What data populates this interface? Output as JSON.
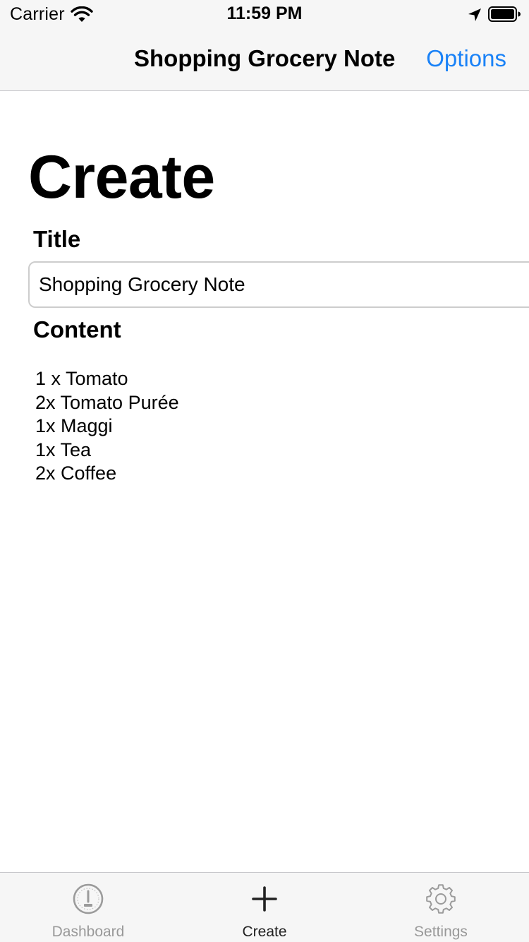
{
  "status_bar": {
    "carrier": "Carrier",
    "time": "11:59 PM",
    "icons": [
      "wifi-icon",
      "location-arrow-icon",
      "battery-icon"
    ]
  },
  "nav_bar": {
    "title": "Shopping Grocery Note",
    "options_label": "Options"
  },
  "page": {
    "title": "Create"
  },
  "form": {
    "title_label": "Title",
    "title_value": "Shopping Grocery Note",
    "content_label": "Content",
    "content_lines": [
      "1 x Tomato",
      "2x Tomato Purée",
      "1x Maggi",
      "1x Tea",
      "2x Coffee"
    ]
  },
  "tab_bar": {
    "items": [
      {
        "label": "Dashboard",
        "icon": "gauge-icon",
        "selected": false
      },
      {
        "label": "Create",
        "icon": "plus-icon",
        "selected": true
      },
      {
        "label": "Settings",
        "icon": "gear-icon",
        "selected": false
      }
    ]
  },
  "colors": {
    "accent": "#1a82f7",
    "bar_background": "#f6f6f6",
    "tab_inactive": "#999999",
    "tab_active": "#222222"
  }
}
